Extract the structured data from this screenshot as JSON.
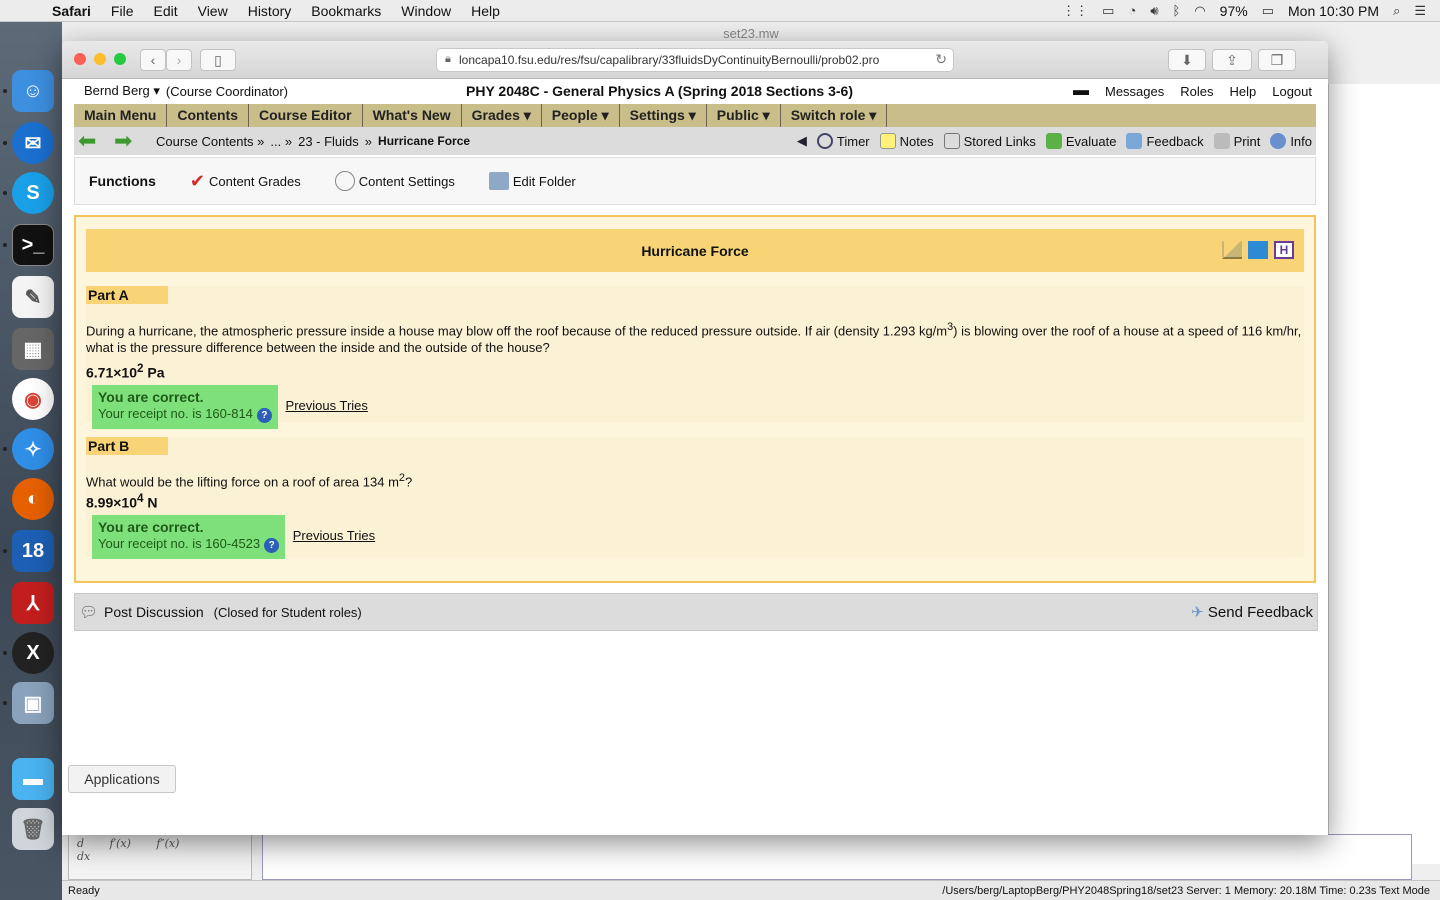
{
  "menubar": {
    "app": "Safari",
    "items": [
      "File",
      "Edit",
      "View",
      "History",
      "Bookmarks",
      "Window",
      "Help"
    ],
    "battery": "97%",
    "clock": "Mon 10:30 PM"
  },
  "bgwindow": {
    "title": "set23.mw",
    "status_left": "Ready",
    "status_right": "/Users/berg/LaptopBerg/PHY2048Spring18/set23   Server: 1   Memory: 20.18M   Time: 0.23s   Text Mode",
    "palette_line1": "d",
    "palette_line2": "dx",
    "palette_f1": "f′(x)",
    "palette_f2": "f″(x)"
  },
  "browser": {
    "url": "loncapa10.fsu.edu/res/fsu/capalibrary/33fluidsDyContinuityBernoulli/prob02.pro"
  },
  "header": {
    "user": "Bernd Berg ▾",
    "role": "(Course Coordinator)",
    "course": "PHY 2048C - General Physics A (Spring 2018 Sections 3-6)",
    "links": [
      "Messages",
      "Roles",
      "Help",
      "Logout"
    ]
  },
  "nav": [
    "Main Menu",
    "Contents",
    "Course Editor",
    "What's New",
    "Grades ▾",
    "People ▾",
    "Settings ▾",
    "Public ▾",
    "Switch role ▾"
  ],
  "breadcrumb": {
    "items": [
      "Course Contents »",
      "... »",
      "23 - Fluids",
      "»",
      "Hurricane Force"
    ],
    "tools": [
      "Timer",
      "Notes",
      "Stored Links",
      "Evaluate",
      "Feedback",
      "Print",
      "Info"
    ]
  },
  "functions": {
    "title": "Functions",
    "items": [
      "Content Grades",
      "Content Settings",
      "Edit Folder"
    ]
  },
  "problem": {
    "title": "Hurricane Force",
    "partA": {
      "label": "Part A",
      "text1": "During a hurricane, the atmospheric pressure inside a house may blow off the roof because of the reduced pressure outside. If air (density 1.293 kg/m",
      "text_sup": "3",
      "text2": ") is blowing over the roof of a house at a speed of 116 km/hr, what is the pressure difference between the inside and the outside of the house?",
      "answer_base": "6.71×10",
      "answer_exp": "2",
      "answer_unit": " Pa",
      "correct": "You are correct.",
      "receipt": "Your receipt no. is 160-814",
      "prev": "Previous Tries"
    },
    "partB": {
      "label": "Part B",
      "text1": "What would be the lifting force on a roof of area 134 m",
      "text_sup": "2",
      "text2": "?",
      "answer_base": "8.99×10",
      "answer_exp": "4",
      "answer_unit": " N",
      "correct": "You are correct.",
      "receipt": "Your receipt no. is 160-4523",
      "prev": "Previous Tries"
    }
  },
  "discussion": {
    "post": "Post Discussion",
    "note": "(Closed for Student roles)",
    "send": "Send Feedback"
  },
  "applications": "Applications"
}
